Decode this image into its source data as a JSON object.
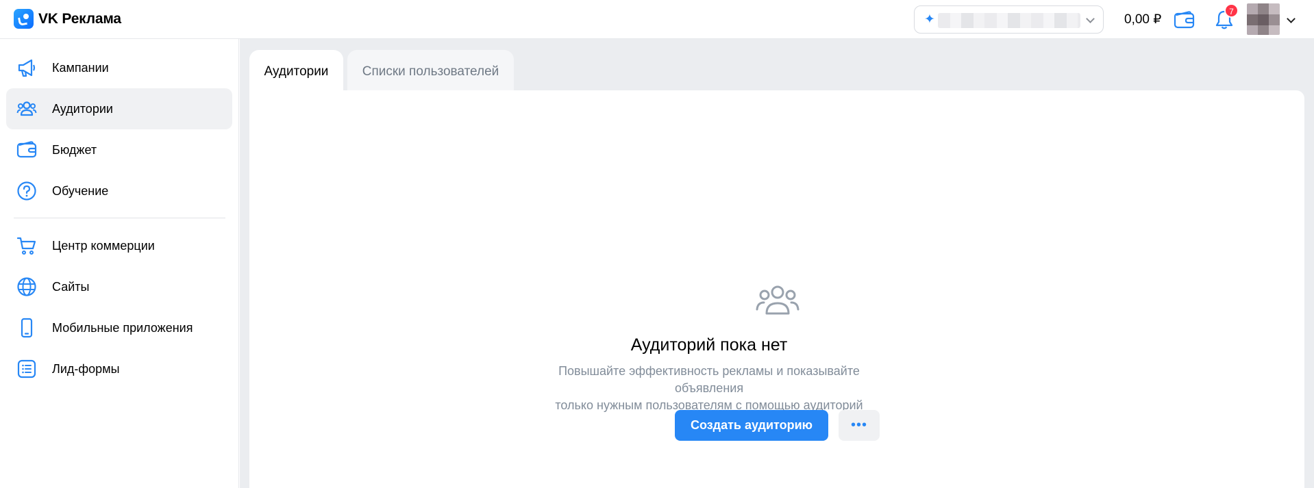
{
  "header": {
    "app_name": "VK Реклама",
    "balance": "0,00 ₽",
    "notifications_count": "7"
  },
  "sidebar": {
    "items": [
      {
        "label": "Кампании",
        "icon": "megaphone-icon"
      },
      {
        "label": "Аудитории",
        "icon": "users-icon",
        "active": true
      },
      {
        "label": "Бюджет",
        "icon": "wallet-icon"
      },
      {
        "label": "Обучение",
        "icon": "question-icon"
      },
      {
        "label": "Центр коммерции",
        "icon": "cart-icon"
      },
      {
        "label": "Сайты",
        "icon": "globe-icon"
      },
      {
        "label": "Мобильные приложения",
        "icon": "smartphone-icon"
      },
      {
        "label": "Лид-формы",
        "icon": "list-icon"
      }
    ]
  },
  "tabs": [
    {
      "label": "Аудитории",
      "active": true
    },
    {
      "label": "Списки пользователей",
      "active": false
    }
  ],
  "empty_state": {
    "title": "Аудиторий пока нет",
    "description_line1": "Повышайте эффективность рекламы и показывайте объявления",
    "description_line2": "только нужным пользователям с помощью аудиторий",
    "create_button": "Создать аудиторию",
    "more_button": "•••"
  },
  "colors": {
    "accent": "#2787f5",
    "badge": "#ff3347",
    "sidebar_active": "#f0f1f3",
    "content_bg": "#ebedf0"
  }
}
